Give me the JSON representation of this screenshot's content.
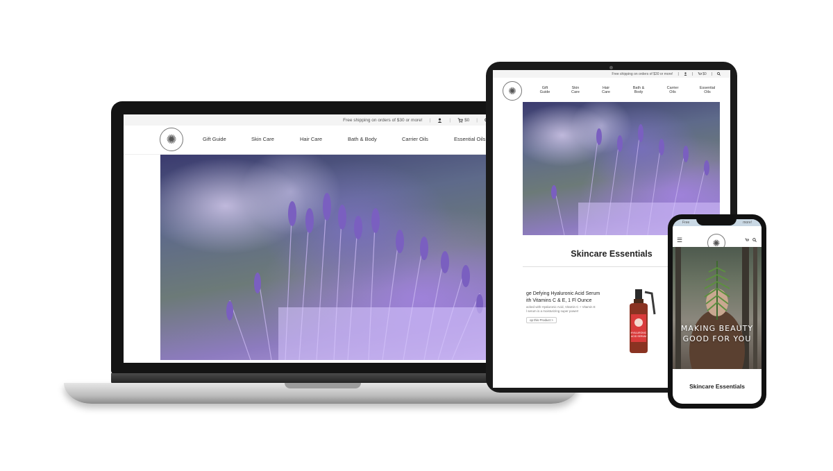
{
  "laptop": {
    "topbar": {
      "shipping": "Free shipping on orders of $30 or more!",
      "cart_count": "$0"
    },
    "menu": [
      "Gift Guide",
      "Skin Care",
      "Hair Care",
      "Bath & Body",
      "Carrier Oils",
      "Essential Oils"
    ]
  },
  "tablet": {
    "topbar": {
      "shipping": "Free shipping on orders of $30 or more!",
      "cart_count": "$0"
    },
    "menu": [
      {
        "line1": "Gift",
        "line2": "Guide"
      },
      {
        "line1": "Skin",
        "line2": "Care"
      },
      {
        "line1": "Hair",
        "line2": "Care"
      },
      {
        "line1": "Bath &",
        "line2": "Body"
      },
      {
        "line1": "Carrier",
        "line2": "Oils"
      },
      {
        "line1": "Essential",
        "line2": "Oils"
      }
    ],
    "section_heading": "Skincare Essentials",
    "product": {
      "title_line1": "ge Defying Hyaluronic Acid Serum",
      "title_line2": "ith Vitamins C & E, 1 Fl Ounce",
      "desc_line1": "acked with Hyaluronic Acid, Vitamin C + Vitamin E",
      "desc_line2": "l serum is a moisturizing super power!",
      "link": "op this Product >",
      "bottle_label_line1": "HYALURONIC",
      "bottle_label_line2": "ACID SERUM"
    }
  },
  "phone": {
    "topbar": {
      "left": "Free",
      "right": "more!"
    },
    "hero_line1": "MAKING BEAUTY",
    "hero_line2": "GOOD FOR YOU",
    "section_heading": "Skincare Essentials"
  },
  "colors": {
    "lavender": "#9a86d6",
    "bezel": "#141414",
    "topbar_bg": "#f4f4f4",
    "phone_topbar_bg": "#c9d8e4"
  },
  "icons": [
    "user-icon",
    "cart-icon",
    "search-icon",
    "hamburger-menu-icon",
    "logo-emblem-icon"
  ]
}
